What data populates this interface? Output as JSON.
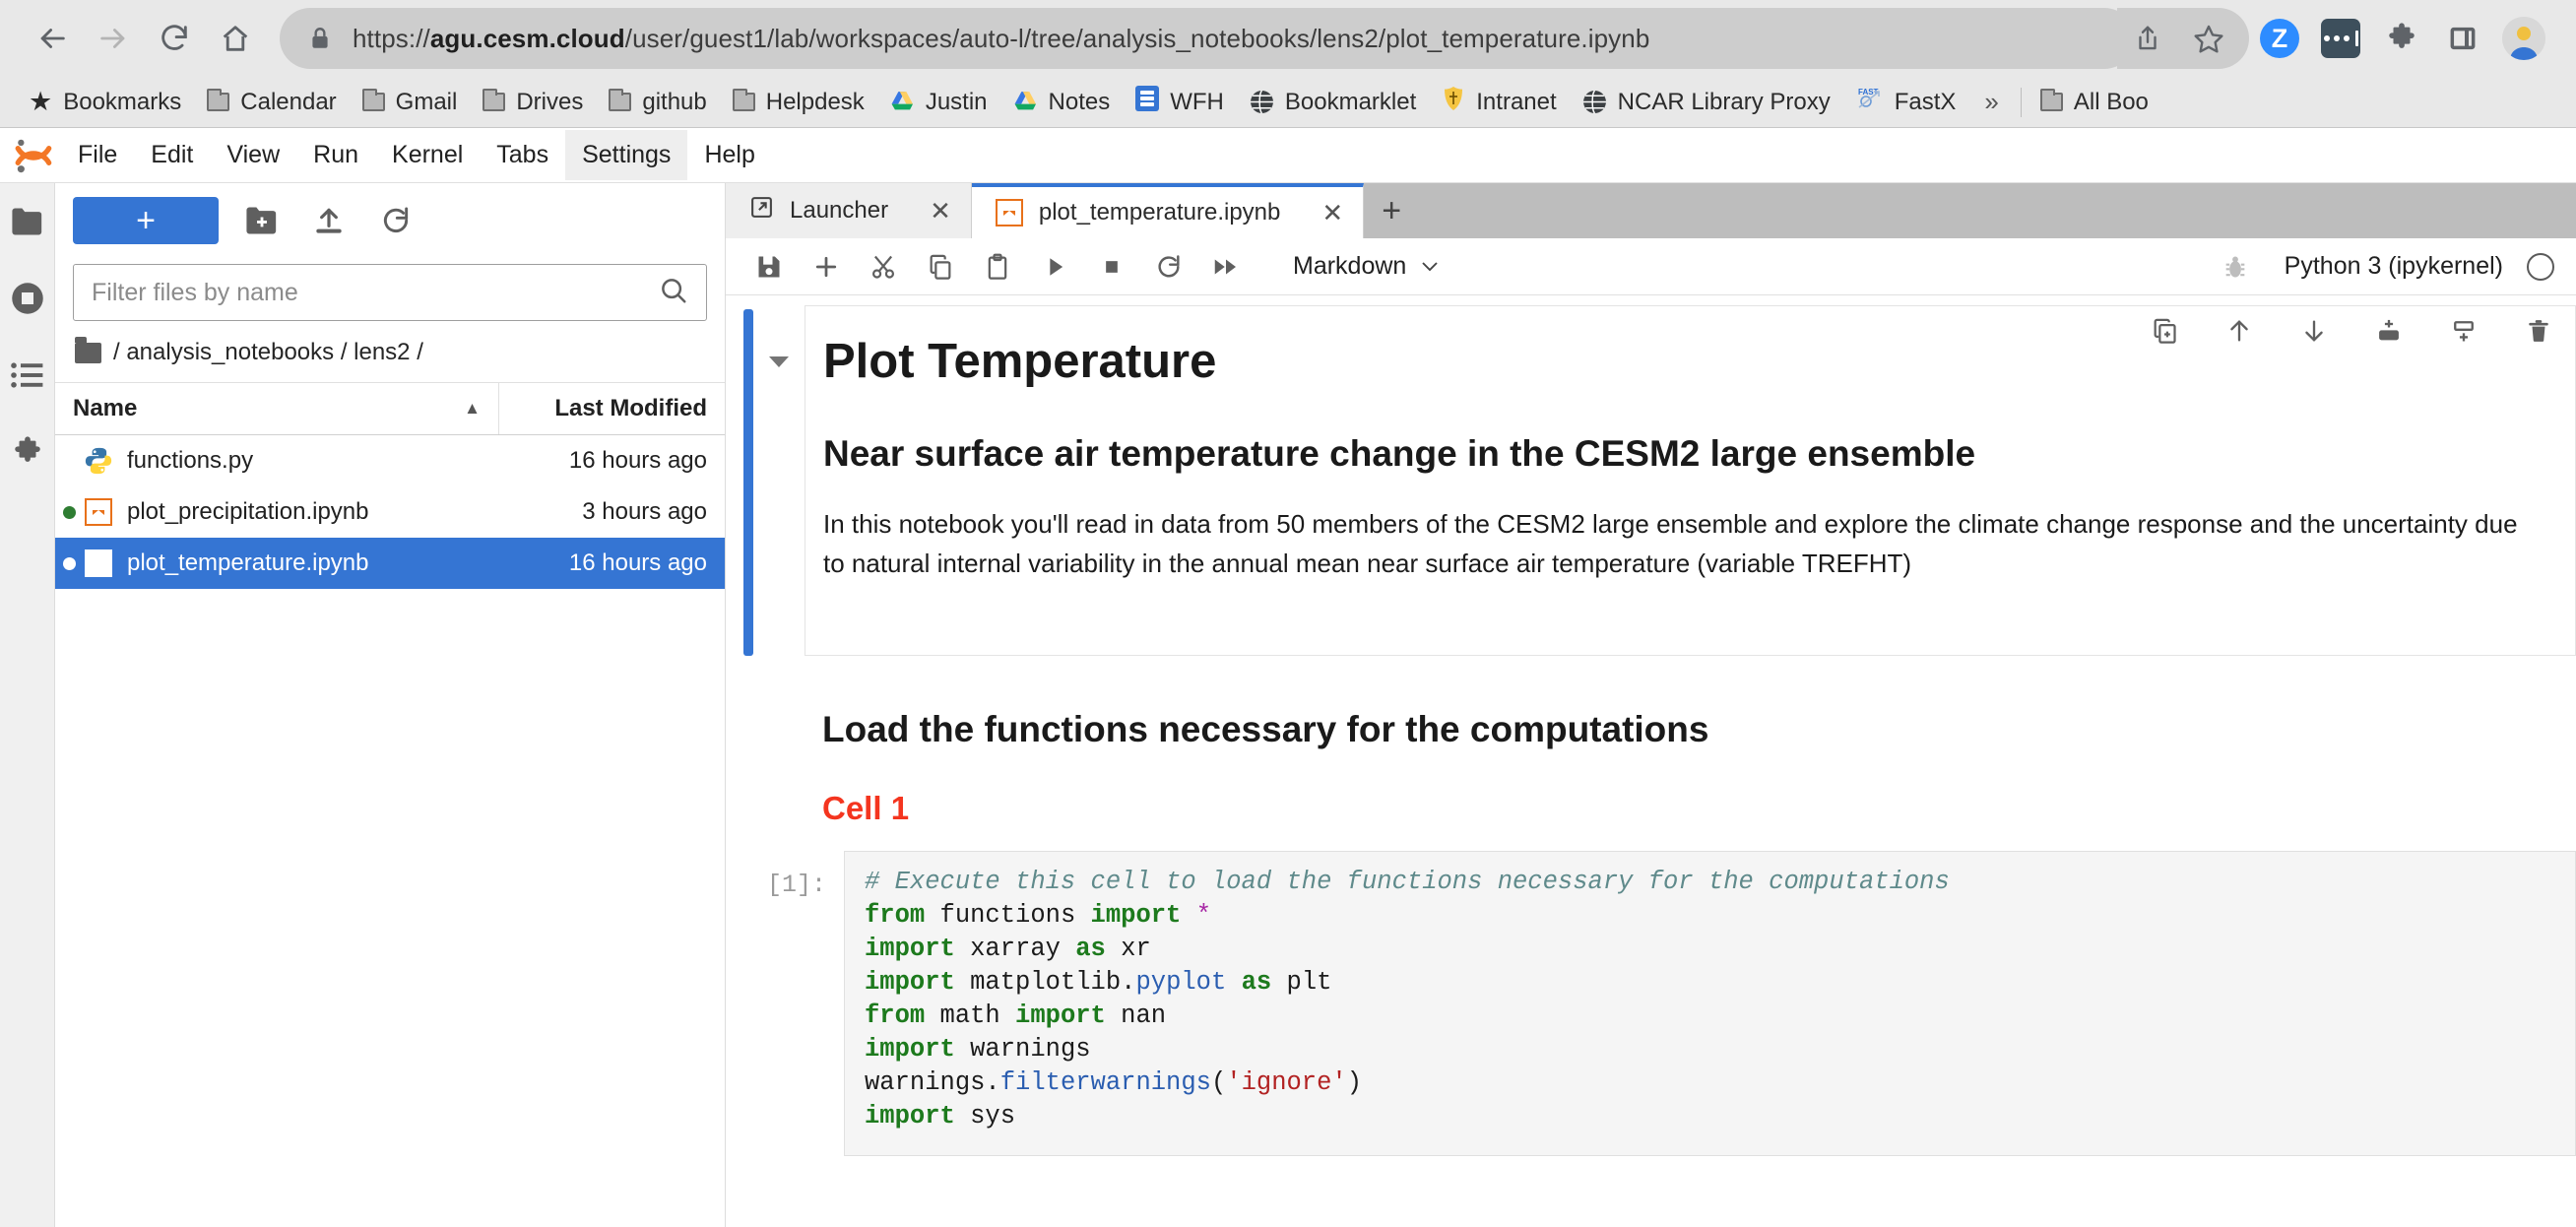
{
  "browser": {
    "url_prefix": "https://",
    "url_host": "agu.cesm.cloud",
    "url_path": "/user/guest1/lab/workspaces/auto-l/tree/analysis_notebooks/lens2/plot_temperature.ipynb",
    "back_icon": "back-arrow-icon",
    "forward_icon": "forward-arrow-icon",
    "reload_icon": "reload-icon",
    "home_icon": "home-icon",
    "lock_icon": "lock-icon",
    "share_icon": "share-icon",
    "bookmark_star_icon": "star-outline-icon",
    "zoom_ext_label": "Z",
    "dots_ext_icon": "dots-extension-icon",
    "puzzle_icon": "extensions-puzzle-icon",
    "sidepanel_icon": "side-panel-icon",
    "avatar_icon": "profile-avatar-icon"
  },
  "bookmarks": {
    "overflow_label": "»",
    "items": [
      {
        "label": "Bookmarks",
        "icon": "star-icon"
      },
      {
        "label": "Calendar",
        "icon": "folder-icon"
      },
      {
        "label": "Gmail",
        "icon": "folder-icon"
      },
      {
        "label": "Drives",
        "icon": "folder-icon"
      },
      {
        "label": "github",
        "icon": "folder-icon"
      },
      {
        "label": "Helpdesk",
        "icon": "folder-icon"
      },
      {
        "label": "Justin",
        "icon": "google-drive-icon"
      },
      {
        "label": "Notes",
        "icon": "google-drive-icon"
      },
      {
        "label": "WFH",
        "icon": "blue-doc-icon"
      },
      {
        "label": "Bookmarklet",
        "icon": "globe-icon"
      },
      {
        "label": "Intranet",
        "icon": "shield-icon"
      },
      {
        "label": "NCAR Library Proxy",
        "icon": "globe-icon"
      },
      {
        "label": "FastX",
        "icon": "fastx-icon"
      }
    ],
    "all_bookmarks": {
      "label": "All Boo",
      "icon": "folder-icon"
    }
  },
  "jupyter": {
    "logo_icon": "jupyter-logo-icon",
    "menu": [
      {
        "label": "File",
        "active": false
      },
      {
        "label": "Edit",
        "active": false
      },
      {
        "label": "View",
        "active": false
      },
      {
        "label": "Run",
        "active": false
      },
      {
        "label": "Kernel",
        "active": false
      },
      {
        "label": "Tabs",
        "active": false
      },
      {
        "label": "Settings",
        "active": true
      },
      {
        "label": "Help",
        "active": false
      }
    ],
    "sidebar_icons": [
      {
        "name": "file-browser-icon",
        "selected": true
      },
      {
        "name": "running-sessions-icon",
        "selected": false
      },
      {
        "name": "table-of-contents-icon",
        "selected": false
      },
      {
        "name": "extension-manager-icon",
        "selected": false
      }
    ]
  },
  "filebrowser": {
    "new_launcher_label": "+",
    "new_folder_icon": "new-folder-icon",
    "upload_icon": "upload-icon",
    "refresh_icon": "refresh-icon",
    "filter_placeholder": "Filter files by name",
    "filter_value": "",
    "search_icon": "search-icon",
    "breadcrumb": "/ analysis_notebooks / lens2 /",
    "columns": {
      "name": "Name",
      "last_modified": "Last Modified"
    },
    "sort_caret": "▲",
    "rows": [
      {
        "name": "functions.py",
        "modified": "16 hours ago",
        "icon": "python-file-icon",
        "dot": "none",
        "selected": false
      },
      {
        "name": "plot_precipitation.ipynb",
        "modified": "3 hours ago",
        "icon": "notebook-file-icon",
        "dot": "green",
        "selected": false
      },
      {
        "name": "plot_temperature.ipynb",
        "modified": "16 hours ago",
        "icon": "notebook-file-icon",
        "dot": "white",
        "selected": true
      }
    ]
  },
  "notebook": {
    "tabs": [
      {
        "label": "Launcher",
        "icon": "launcher-icon",
        "active": false,
        "close": "✕"
      },
      {
        "label": "plot_temperature.ipynb",
        "icon": "notebook-file-icon",
        "active": true,
        "close": "✕"
      }
    ],
    "new_tab_label": "+",
    "toolbar_buttons": [
      {
        "name": "save-button",
        "icon": "save-icon"
      },
      {
        "name": "insert-cell-button",
        "icon": "plus-icon"
      },
      {
        "name": "cut-cell-button",
        "icon": "scissors-icon"
      },
      {
        "name": "copy-cell-button",
        "icon": "copy-icon"
      },
      {
        "name": "paste-cell-button",
        "icon": "clipboard-icon"
      },
      {
        "name": "run-cell-button",
        "icon": "play-icon"
      },
      {
        "name": "interrupt-kernel-button",
        "icon": "stop-square-icon"
      },
      {
        "name": "restart-kernel-button",
        "icon": "restart-icon"
      },
      {
        "name": "restart-run-all-button",
        "icon": "fast-forward-icon"
      }
    ],
    "cell_type": "Markdown",
    "cell_type_caret": "⌄",
    "debugger_icon": "bug-icon",
    "kernel_name": "Python 3 (ipykernel)",
    "kernel_status_icon": "kernel-idle-circle-icon",
    "cell_actions": [
      {
        "name": "duplicate-cell-button",
        "icon": "duplicate-icon"
      },
      {
        "name": "move-cell-up-button",
        "icon": "arrow-up-icon"
      },
      {
        "name": "move-cell-down-button",
        "icon": "arrow-down-icon"
      },
      {
        "name": "insert-cell-above-button",
        "icon": "insert-above-icon"
      },
      {
        "name": "insert-cell-below-button",
        "icon": "insert-below-icon"
      },
      {
        "name": "delete-cell-button",
        "icon": "trash-icon"
      }
    ],
    "collapse_caret": "▾",
    "cells": {
      "title": "Plot Temperature",
      "subtitle": "Near surface air temperature change in the CESM2 large ensemble",
      "paragraph": "In this notebook you'll read in data from 50 members of the CESM2 large ensemble and explore the climate change response and the uncertainty due to natural internal variability in the annual mean near surface air temperature (variable TREFHT)",
      "section_heading": "Load the functions necessary for the computations",
      "cell_label": "Cell 1",
      "code_prompt": "[1]:",
      "code_lines": [
        {
          "tokens": [
            {
              "t": "# Execute this cell to load the functions necessary for the computations",
              "c": "tok-com"
            }
          ]
        },
        {
          "tokens": [
            {
              "t": "from",
              "c": "tok-kw"
            },
            {
              "t": " functions ",
              "c": ""
            },
            {
              "t": "import",
              "c": "tok-kw"
            },
            {
              "t": " ",
              "c": ""
            },
            {
              "t": "*",
              "c": "tok-op"
            }
          ]
        },
        {
          "tokens": [
            {
              "t": "import",
              "c": "tok-kw"
            },
            {
              "t": " xarray ",
              "c": ""
            },
            {
              "t": "as",
              "c": "tok-kw"
            },
            {
              "t": " xr",
              "c": ""
            }
          ]
        },
        {
          "tokens": [
            {
              "t": "import",
              "c": "tok-kw"
            },
            {
              "t": " matplotlib.",
              "c": ""
            },
            {
              "t": "pyplot",
              "c": "tok-mod"
            },
            {
              "t": " ",
              "c": ""
            },
            {
              "t": "as",
              "c": "tok-kw"
            },
            {
              "t": " plt",
              "c": ""
            }
          ]
        },
        {
          "tokens": [
            {
              "t": "from",
              "c": "tok-kw"
            },
            {
              "t": " math ",
              "c": ""
            },
            {
              "t": "import",
              "c": "tok-kw"
            },
            {
              "t": " nan",
              "c": ""
            }
          ]
        },
        {
          "tokens": [
            {
              "t": "import",
              "c": "tok-kw"
            },
            {
              "t": " warnings",
              "c": ""
            }
          ]
        },
        {
          "tokens": [
            {
              "t": "warnings.",
              "c": ""
            },
            {
              "t": "filterwarnings",
              "c": "tok-fn"
            },
            {
              "t": "(",
              "c": ""
            },
            {
              "t": "'ignore'",
              "c": "tok-str"
            },
            {
              "t": ")",
              "c": ""
            }
          ]
        },
        {
          "tokens": [
            {
              "t": "import",
              "c": "tok-kw"
            },
            {
              "t": " sys",
              "c": ""
            }
          ]
        }
      ]
    }
  },
  "colors": {
    "accent_blue": "#3575d3",
    "jupyter_orange": "#e8711a",
    "selected_row_blue": "#3575d3",
    "cell_label_red": "#f4351f"
  }
}
